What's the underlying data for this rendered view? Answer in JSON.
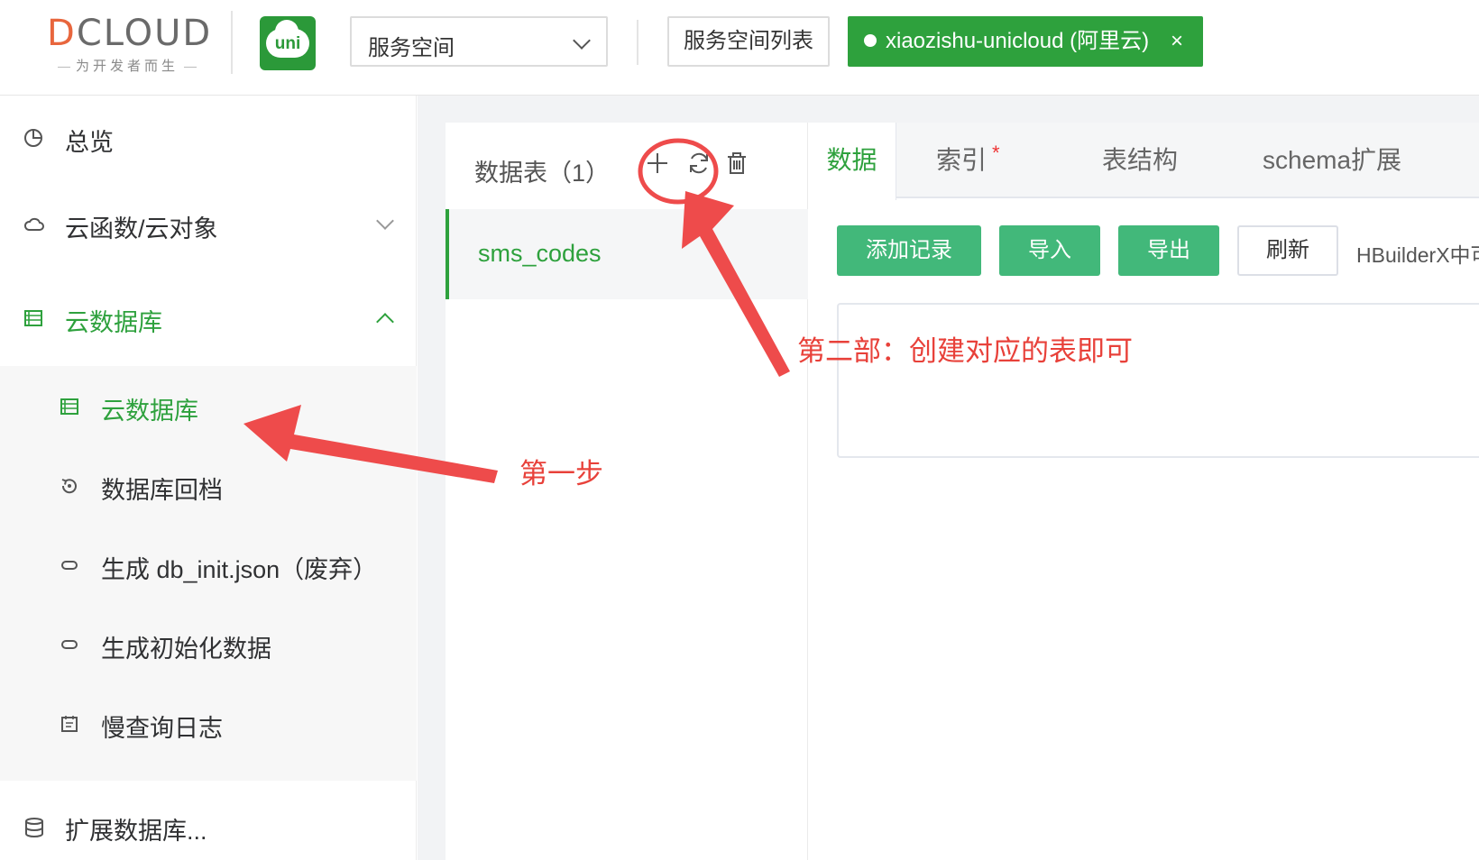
{
  "header": {
    "logo_text": "DCLOUD",
    "logo_tagline": "为开发者而生",
    "uni_logo_text": "uni",
    "space_select_value": "服务空间",
    "space_list_button": "服务空间列表",
    "current_space": "xiaozishu-unicloud (阿里云)",
    "current_space_close": "×"
  },
  "sidebar": {
    "items": [
      {
        "label": "总览",
        "icon": "pie-chart-icon"
      },
      {
        "label": "云函数/云对象",
        "icon": "cloud-icon"
      },
      {
        "label": "云数据库",
        "icon": "database-list-icon"
      },
      {
        "label": "扩展数据库...",
        "icon": "database-stack-icon"
      }
    ],
    "subitems": [
      {
        "label": "云数据库",
        "icon": "database-list-icon"
      },
      {
        "label": "数据库回档",
        "icon": "rollback-icon"
      },
      {
        "label": "生成 db_init.json（废弃）",
        "icon": "link-icon"
      },
      {
        "label": "生成初始化数据",
        "icon": "link-icon"
      },
      {
        "label": "慢查询日志",
        "icon": "log-icon"
      }
    ]
  },
  "tables_panel": {
    "title": "数据表（1）",
    "tables": [
      "sms_codes"
    ]
  },
  "tabs": [
    "数据",
    "索引",
    "表结构",
    "schema扩展"
  ],
  "index_tab_marker": "*",
  "toolbar": {
    "add_record": "添加记录",
    "import": "导入",
    "export": "导出",
    "refresh": "刷新",
    "hbuilder_note": "HBuilderX中可"
  },
  "annotations": {
    "step_one": "第一步",
    "step_two": "第二部：创建对应的表即可"
  },
  "colors": {
    "brand_green": "#2ea13d",
    "button_green": "#42b87a",
    "annotation_red": "#e8413a"
  }
}
